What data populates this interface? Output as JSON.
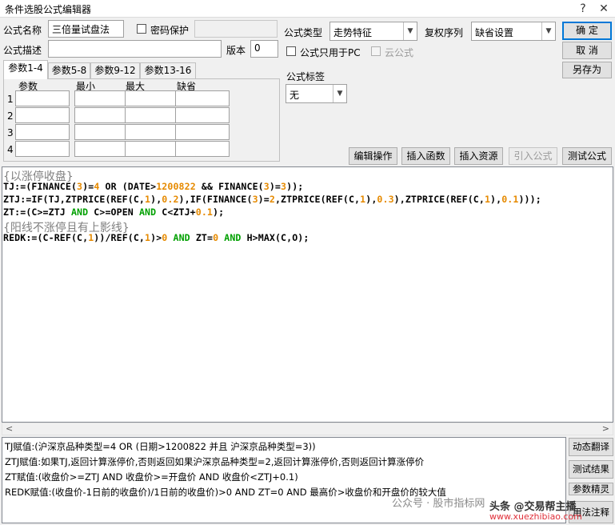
{
  "window": {
    "title": "条件选股公式编辑器"
  },
  "form": {
    "name_label": "公式名称",
    "name_value": "三倍量试盘法",
    "password_label": "密码保护",
    "desc_label": "公式描述",
    "desc_value": "",
    "version_label": "版本",
    "version_value": "0",
    "type_label": "公式类型",
    "type_value": "走势特征",
    "rights_label": "复权序列",
    "rights_value": "缺省设置",
    "pc_only_label": "公式只用于PC",
    "cloud_label": "云公式",
    "tag_label": "公式标签",
    "tag_value": "无"
  },
  "buttons": {
    "ok": "确 定",
    "cancel": "取 消",
    "save_as": "另存为",
    "edit_ops": "编辑操作",
    "insert_func": "插入函数",
    "insert_res": "插入资源",
    "import_formula": "引入公式",
    "test_formula": "测试公式"
  },
  "params": {
    "tabs": [
      "参数1-4",
      "参数5-8",
      "参数9-12",
      "参数13-16"
    ],
    "headers": [
      "参数",
      "最小",
      "最大",
      "缺省"
    ],
    "rows": [
      "1",
      "2",
      "3",
      "4"
    ]
  },
  "code": [
    [
      {
        "t": "{以涨停收盘}",
        "c": "cmt"
      }
    ],
    [
      {
        "t": "TJ:=(FINANCE(",
        "c": "#000000"
      },
      {
        "t": "3",
        "c": "#e68a00"
      },
      {
        "t": ")=",
        "c": "#000000"
      },
      {
        "t": "4",
        "c": "#e68a00"
      },
      {
        "t": " OR (DATE>",
        "c": "#000000"
      },
      {
        "t": "1200822",
        "c": "#e68a00"
      },
      {
        "t": " && FINANCE(",
        "c": "#000000"
      },
      {
        "t": "3",
        "c": "#e68a00"
      },
      {
        "t": ")=",
        "c": "#000000"
      },
      {
        "t": "3",
        "c": "#e68a00"
      },
      {
        "t": "));",
        "c": "#000000"
      }
    ],
    [
      {
        "t": "ZTJ:=IF(TJ,ZTPRICE(REF(C,",
        "c": "#000000"
      },
      {
        "t": "1",
        "c": "#e68a00"
      },
      {
        "t": "),",
        "c": "#000000"
      },
      {
        "t": "0.2",
        "c": "#e68a00"
      },
      {
        "t": "),IF(FINANCE(",
        "c": "#000000"
      },
      {
        "t": "3",
        "c": "#e68a00"
      },
      {
        "t": ")=",
        "c": "#000000"
      },
      {
        "t": "2",
        "c": "#e68a00"
      },
      {
        "t": ",ZTPRICE(REF(C,",
        "c": "#000000"
      },
      {
        "t": "1",
        "c": "#e68a00"
      },
      {
        "t": "),",
        "c": "#000000"
      },
      {
        "t": "0.3",
        "c": "#e68a00"
      },
      {
        "t": "),ZTPRICE(REF(C,",
        "c": "#000000"
      },
      {
        "t": "1",
        "c": "#e68a00"
      },
      {
        "t": "),",
        "c": "#000000"
      },
      {
        "t": "0.1",
        "c": "#e68a00"
      },
      {
        "t": ")));",
        "c": "#000000"
      }
    ],
    [
      {
        "t": "ZT:=(C>=ZTJ ",
        "c": "#000000"
      },
      {
        "t": "AND",
        "c": "#00a000"
      },
      {
        "t": " C>=OPEN ",
        "c": "#000000"
      },
      {
        "t": "AND",
        "c": "#00a000"
      },
      {
        "t": " C<ZTJ+",
        "c": "#000000"
      },
      {
        "t": "0.1",
        "c": "#e68a00"
      },
      {
        "t": ");",
        "c": "#000000"
      }
    ],
    [
      {
        "t": "{阳线不涨停且有上影线}",
        "c": "cmt"
      }
    ],
    [
      {
        "t": "REDK:=(C-REF(C,",
        "c": "#000000"
      },
      {
        "t": "1",
        "c": "#e68a00"
      },
      {
        "t": "))/REF(C,",
        "c": "#000000"
      },
      {
        "t": "1",
        "c": "#e68a00"
      },
      {
        "t": ")>",
        "c": "#000000"
      },
      {
        "t": "0",
        "c": "#e68a00"
      },
      {
        "t": " ",
        "c": "#000000"
      },
      {
        "t": "AND",
        "c": "#00a000"
      },
      {
        "t": " ZT=",
        "c": "#000000"
      },
      {
        "t": "0",
        "c": "#e68a00"
      },
      {
        "t": " ",
        "c": "#000000"
      },
      {
        "t": "AND",
        "c": "#00a000"
      },
      {
        "t": " H>MAX(C,O);",
        "c": "#000000"
      }
    ]
  ],
  "translation": [
    "TJ赋值:(沪深京品种类型=4 OR (日期>1200822 并且 沪深京品种类型=3))",
    "ZTJ赋值:如果TJ,返回计算涨停价,否则返回如果沪深京品种类型=2,返回计算涨停价,否则返回计算涨停价",
    "ZT赋值:(收盘价>=ZTJ AND 收盘价>=开盘价 AND 收盘价<ZTJ+0.1)",
    "REDK赋值:(收盘价-1日前的收盘价)/1日前的收盘价)>0 AND ZT=0 AND 最高价>收盘价和开盘价的较大值"
  ],
  "side_buttons": {
    "translate": "动态翻译",
    "test_results": "测试结果",
    "param_wizard": "参数精灵",
    "usage": "用法注释"
  },
  "watermark": {
    "wechat": "公众号 · 股市指标网",
    "site": "www.xuezhibiao.com",
    "toutiao": "头条 @交易帮主播"
  }
}
